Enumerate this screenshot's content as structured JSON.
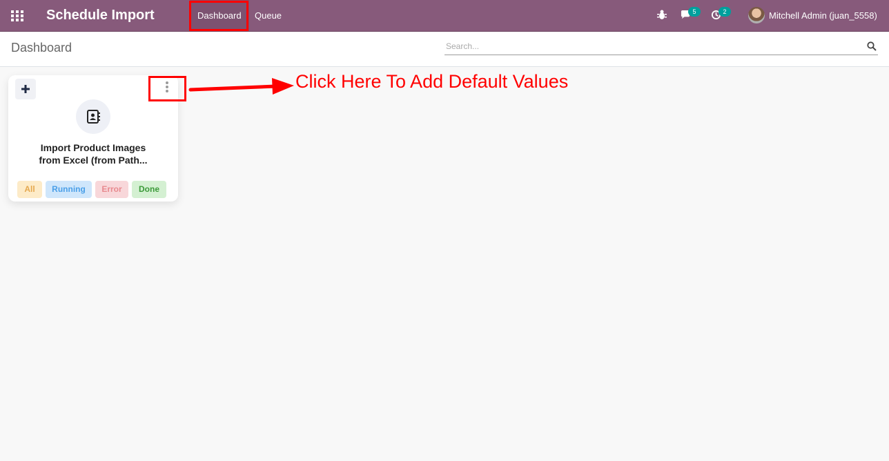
{
  "header": {
    "app_title": "Schedule Import",
    "menu": [
      {
        "label": "Dashboard"
      },
      {
        "label": "Queue"
      }
    ],
    "messages_count": "5",
    "activities_count": "2",
    "user": "Mitchell Admin (juan_5558)"
  },
  "control_panel": {
    "breadcrumb": "Dashboard",
    "search_placeholder": "Search..."
  },
  "card": {
    "title_line1": "Import Product Images",
    "title_line2": "from Excel (from Path...",
    "chips": [
      {
        "label": "All"
      },
      {
        "label": "Running"
      },
      {
        "label": "Error"
      },
      {
        "label": "Done"
      }
    ]
  },
  "annotation": {
    "text": "Click Here To Add Default Values"
  },
  "icons": [
    "apps-grid-icon",
    "bug-icon",
    "chat-icon",
    "clock-icon",
    "plus-icon",
    "vertical-dots-icon",
    "address-book-icon",
    "search-icon"
  ],
  "colors": {
    "topbar": "#875a7b",
    "highlight": "#ff0000"
  }
}
